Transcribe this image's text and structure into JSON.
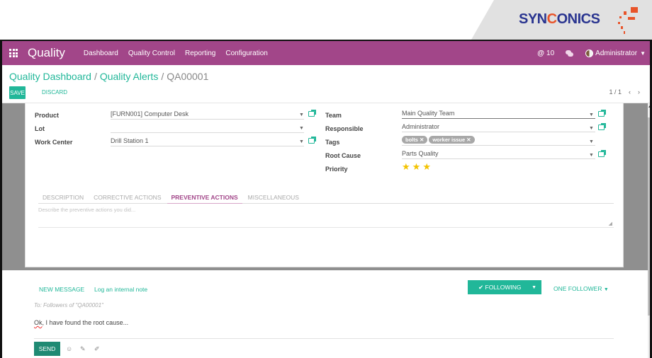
{
  "brand": {
    "logo_prefix": "SYN",
    "logo_c": "C",
    "logo_suffix": "ONICS"
  },
  "navbar": {
    "app_title": "Quality",
    "menu": [
      "Dashboard",
      "Quality Control",
      "Reporting",
      "Configuration"
    ],
    "notifications_count": "10",
    "user": "Administrator",
    "color": "#a24689"
  },
  "breadcrumb": {
    "items": [
      "Quality Dashboard",
      "Quality Alerts"
    ],
    "current": "QA00001"
  },
  "buttons": {
    "save": "SAVE",
    "discard": "DISCARD"
  },
  "pager": {
    "value": "1 / 1",
    "prev": "‹",
    "next": "›"
  },
  "form": {
    "left": [
      {
        "label": "Product",
        "value": "[FURN001] Computer Desk",
        "external": true
      },
      {
        "label": "Lot",
        "value": "",
        "external": false
      },
      {
        "label": "Work Center",
        "value": "Drill Station 1",
        "external": true
      }
    ],
    "right": {
      "team": {
        "label": "Team",
        "value": "Main Quality Team"
      },
      "responsible": {
        "label": "Responsible",
        "value": "Administrator"
      },
      "tags": {
        "label": "Tags",
        "values": [
          "bolts",
          "worker issue"
        ]
      },
      "root_cause": {
        "label": "Root Cause",
        "value": "Parts Quality"
      },
      "priority": {
        "label": "Priority",
        "stars": 3,
        "max": 3
      }
    },
    "tabs": [
      "DESCRIPTION",
      "CORRECTIVE ACTIONS",
      "PREVENTIVE ACTIONS",
      "MISCELLANEOUS"
    ],
    "active_tab": "PREVENTIVE ACTIONS",
    "tab_placeholder": "Describe the preventive actions you did..."
  },
  "chatter": {
    "new_message": "NEW MESSAGE",
    "log_note": "Log an internal note",
    "following": "FOLLOWING",
    "followers": "ONE FOLLOWER",
    "to_line": "To: Followers of \"QA00001\"",
    "message_first": "Ok",
    "message_rest": ", I have found the root cause...",
    "send": "SEND"
  },
  "colors": {
    "accent": "#21b799",
    "brand_purple": "#a24689",
    "star": "#f3c300"
  }
}
